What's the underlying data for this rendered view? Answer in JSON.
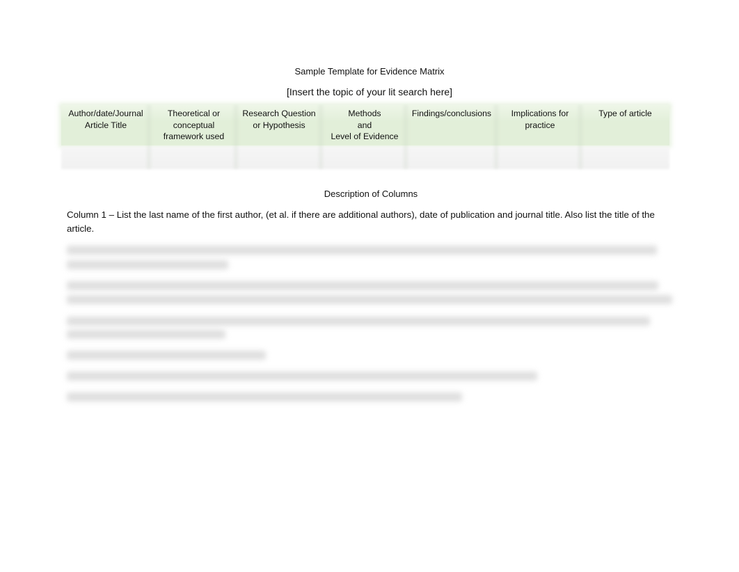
{
  "document": {
    "title": "Sample Template for Evidence Matrix",
    "topic_placeholder": "[Insert the topic of your lit search here]",
    "matrix": {
      "header_color": "#e2efd9",
      "columns": [
        {
          "label": "Author/date/Journal\nArticle Title"
        },
        {
          "label": "Theoretical or\nconceptual\nframework used"
        },
        {
          "label": "Research Question\nor Hypothesis"
        },
        {
          "label": "Methods\nand\nLevel of Evidence"
        },
        {
          "label": "Findings/conclusions"
        },
        {
          "label": "Implications for\npractice"
        },
        {
          "label": "Type of article"
        }
      ],
      "rows": [
        [
          "",
          "",
          "",
          "",
          "",
          "",
          ""
        ]
      ]
    },
    "description": {
      "heading": "Description of Columns",
      "column1": "Column 1 – List the last name of the first author, (et al. if there are additional authors), date of publication and journal title. Also list the title of the article.",
      "blurred_paragraphs": 6
    }
  }
}
